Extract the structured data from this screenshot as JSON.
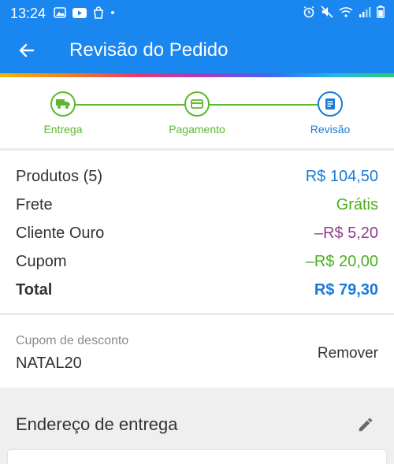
{
  "status_bar": {
    "time": "13:24",
    "left_icons": [
      "photo-icon",
      "youtube-icon",
      "shopping-icon",
      "dot-icon"
    ],
    "right_icons": [
      "alarm-icon",
      "mute-icon",
      "wifi-icon",
      "signal-icon",
      "battery-icon"
    ]
  },
  "header": {
    "title": "Revisão do Pedido",
    "back_icon": "arrow-left-icon"
  },
  "stepper": {
    "steps": [
      {
        "label": "Entrega",
        "icon": "truck-icon",
        "state": "done"
      },
      {
        "label": "Pagamento",
        "icon": "card-icon",
        "state": "done"
      },
      {
        "label": "Revisão",
        "icon": "document-icon",
        "state": "active"
      }
    ]
  },
  "summary": {
    "rows": [
      {
        "label": "Produtos (5)",
        "value": "R$ 104,50",
        "color": "#1a7bd6"
      },
      {
        "label": "Frete",
        "value": "Grátis",
        "color": "#4caf1f"
      },
      {
        "label": "Cliente Ouro",
        "value": "–R$ 5,20",
        "color": "#8e3e8e"
      },
      {
        "label": "Cupom",
        "value": "–R$ 20,00",
        "color": "#4caf1f"
      },
      {
        "label": "Total",
        "value": "R$ 79,30",
        "color": "#1a7bd6"
      }
    ]
  },
  "coupon": {
    "label": "Cupom de desconto",
    "code": "NATAL20",
    "remove_label": "Remover"
  },
  "address": {
    "title": "Endereço de entrega",
    "edit_icon": "pencil-icon"
  },
  "colors": {
    "primary": "#1a86f0",
    "success": "#5cb82e",
    "active": "#1a7bd6"
  }
}
